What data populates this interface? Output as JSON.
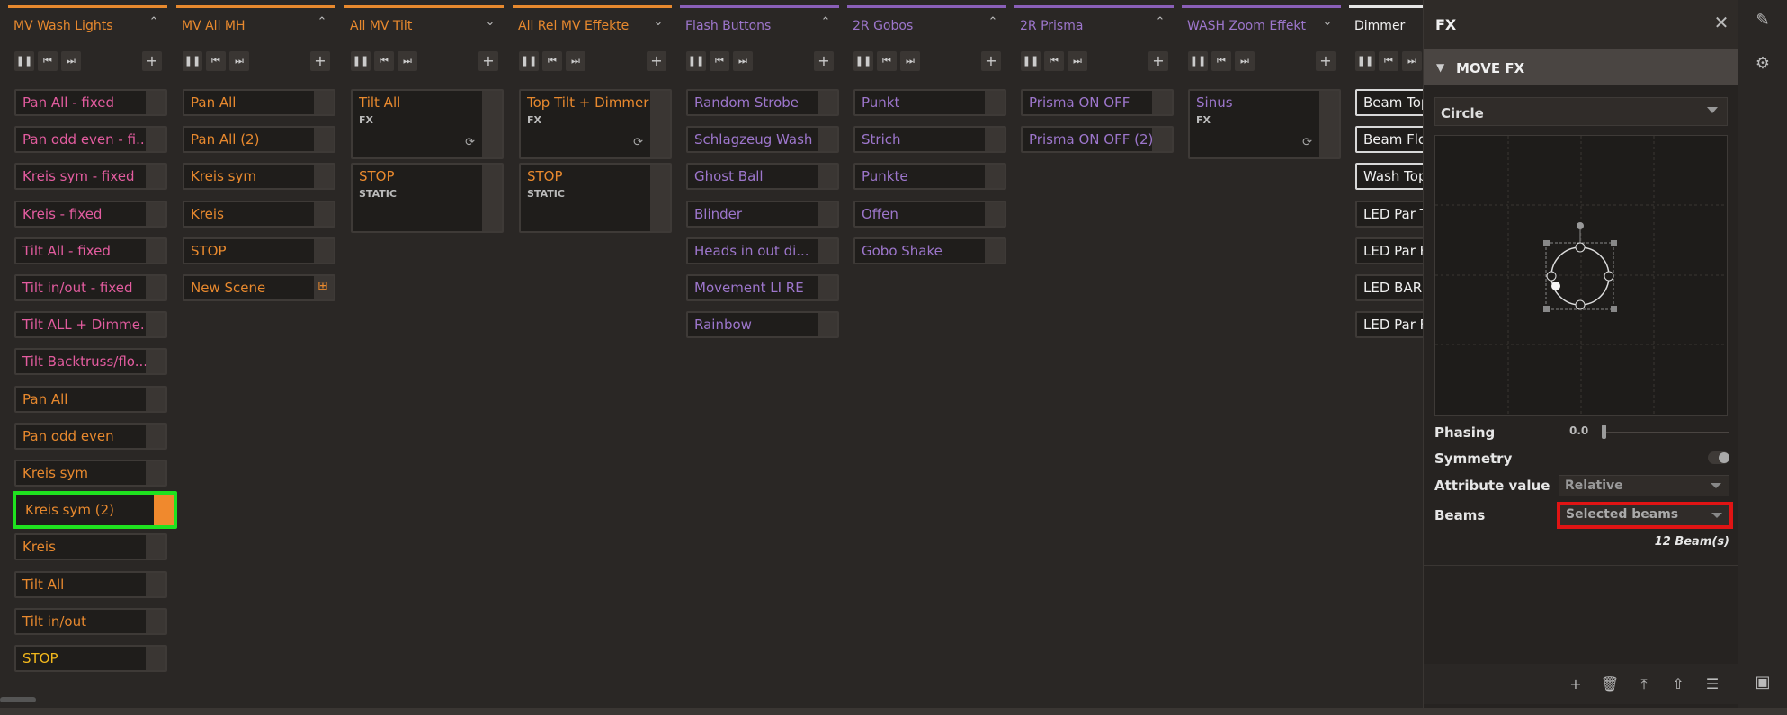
{
  "columns": [
    {
      "title": "MV Wash Lights",
      "accent": "orange",
      "executors": [
        {
          "label": "Pan All - fixed",
          "color": "pink"
        },
        {
          "label": "Pan odd even - fi...",
          "color": "pink"
        },
        {
          "label": "Kreis sym - fixed",
          "color": "pink"
        },
        {
          "label": "Kreis - fixed",
          "color": "pink"
        },
        {
          "label": "Tilt All - fixed",
          "color": "pink"
        },
        {
          "label": "Tilt in/out - fixed",
          "color": "pink"
        },
        {
          "label": "Tilt ALL + Dimme...",
          "color": "pink"
        },
        {
          "label": "Tilt Backtruss/flo...",
          "color": "pink"
        },
        {
          "label": "Pan All",
          "color": "orange"
        },
        {
          "label": "Pan odd even",
          "color": "orange"
        },
        {
          "label": "Kreis sym",
          "color": "orange"
        },
        {
          "label": "Kreis sym (2)",
          "color": "orange"
        },
        {
          "label": "Kreis",
          "color": "orange"
        },
        {
          "label": "Tilt All",
          "color": "orange"
        },
        {
          "label": "Tilt in/out",
          "color": "orange"
        },
        {
          "label": "STOP",
          "color": "yellow"
        }
      ]
    },
    {
      "title": "MV All MH",
      "accent": "orange",
      "executors": [
        {
          "label": "Pan All",
          "color": "orange"
        },
        {
          "label": "Pan All (2)",
          "color": "orange"
        },
        {
          "label": "Kreis sym",
          "color": "orange"
        },
        {
          "label": "Kreis",
          "color": "orange"
        },
        {
          "label": "STOP",
          "color": "orange"
        },
        {
          "label": "New Scene",
          "color": "orange"
        }
      ]
    },
    {
      "title": "All MV Tilt",
      "accent": "orange",
      "executors": [
        {
          "label": "Tilt All",
          "sub": "FX",
          "color": "orange"
        },
        {
          "label": "STOP",
          "sub": "STATIC",
          "color": "orange"
        }
      ]
    },
    {
      "title": "All Rel MV Effekte",
      "accent": "orange",
      "executors": [
        {
          "label": "Top Tilt + Dimmer",
          "sub": "FX",
          "color": "orange"
        },
        {
          "label": "STOP",
          "sub": "STATIC",
          "color": "orange"
        }
      ]
    },
    {
      "title": "Flash Buttons",
      "accent": "purple",
      "executors": [
        {
          "label": "Random Strobe",
          "color": "purple"
        },
        {
          "label": "Schlagzeug Wash",
          "color": "purple"
        },
        {
          "label": "Ghost Ball",
          "color": "purple"
        },
        {
          "label": "Blinder",
          "color": "purple"
        },
        {
          "label": "Heads in out di...",
          "color": "purple"
        },
        {
          "label": "Movement LI RE",
          "color": "purple"
        },
        {
          "label": "Rainbow",
          "color": "purple"
        }
      ]
    },
    {
      "title": "2R Gobos",
      "accent": "purple",
      "executors": [
        {
          "label": "Punkt",
          "color": "purple"
        },
        {
          "label": "Strich",
          "color": "purple"
        },
        {
          "label": "Punkte",
          "color": "purple"
        },
        {
          "label": "Offen",
          "color": "purple"
        },
        {
          "label": "Gobo Shake",
          "color": "purple"
        }
      ]
    },
    {
      "title": "2R Prisma",
      "accent": "purple",
      "executors": [
        {
          "label": "Prisma ON OFF",
          "color": "purple"
        },
        {
          "label": "Prisma ON OFF (2)",
          "color": "purple"
        }
      ]
    },
    {
      "title": "WASH Zoom Effekt",
      "accent": "purple",
      "executors": [
        {
          "label": "Sinus",
          "sub": "FX",
          "color": "purple"
        }
      ]
    },
    {
      "title": "Dimmer",
      "accent": "white",
      "executors": [
        {
          "label": "Beam Top",
          "color": "white"
        },
        {
          "label": "Beam Floo",
          "color": "white"
        },
        {
          "label": "Wash Top",
          "color": "white"
        },
        {
          "label": "LED Par To",
          "color": "white"
        },
        {
          "label": "LED Par Fl",
          "color": "white"
        },
        {
          "label": "LED BAR",
          "color": "white"
        },
        {
          "label": "LED Par Fl",
          "color": "white"
        }
      ]
    }
  ],
  "fx": {
    "title": "FX",
    "section": "MOVE FX",
    "shape": "Circle",
    "phasing_label": "Phasing",
    "phasing_value": "0.0",
    "symmetry_label": "Symmetry",
    "attribute_label": "Attribute value",
    "attribute_value": "Relative",
    "beams_label": "Beams",
    "beams_value": "Selected beams",
    "beam_count": "12 Beam(s)"
  },
  "colors": {
    "orange": "#e8892e",
    "pink": "#e35c9f",
    "yellow": "#f2b81c",
    "purple": "#9d76cc",
    "white": "#f0f0f0",
    "highlight_green": "#1fe21f",
    "highlight_red": "#e01414"
  }
}
